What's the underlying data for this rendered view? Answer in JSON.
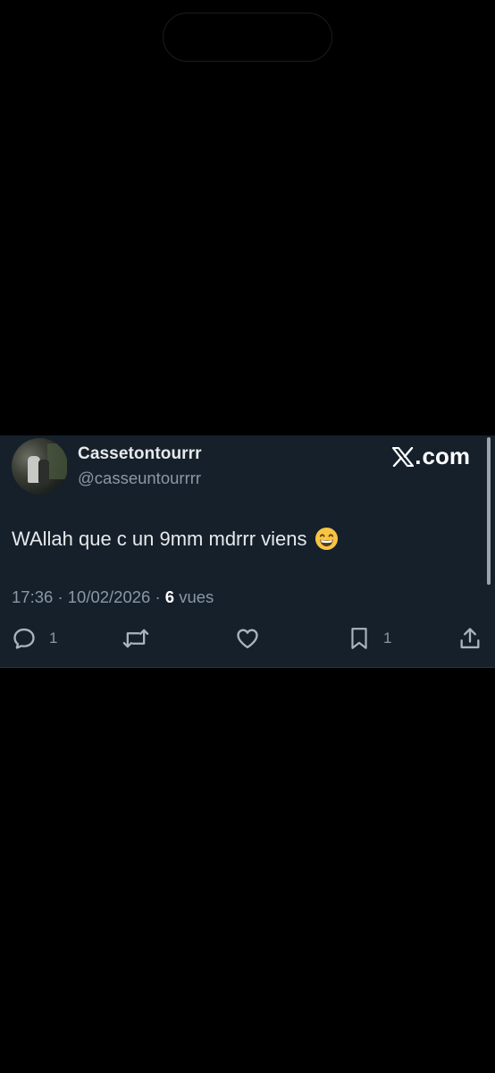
{
  "tweet": {
    "display_name": "Cassetontourrr",
    "handle": "@casseuntourrrr",
    "brand": "com",
    "text": "WAllah que c un 9mm mdrrr viens",
    "emoji": "grinning-face-emoji",
    "time": "17:36",
    "date": "10/02/2026",
    "views_count": "6",
    "views_label": "vues",
    "actions": {
      "reply_count": "1",
      "retweet_count": "",
      "like_count": "",
      "bookmark_count": "1"
    }
  },
  "colors": {
    "card_bg": "#15202b",
    "text_primary": "#e7e9ea",
    "text_secondary": "#8b98a5",
    "page_bg": "#000000"
  }
}
